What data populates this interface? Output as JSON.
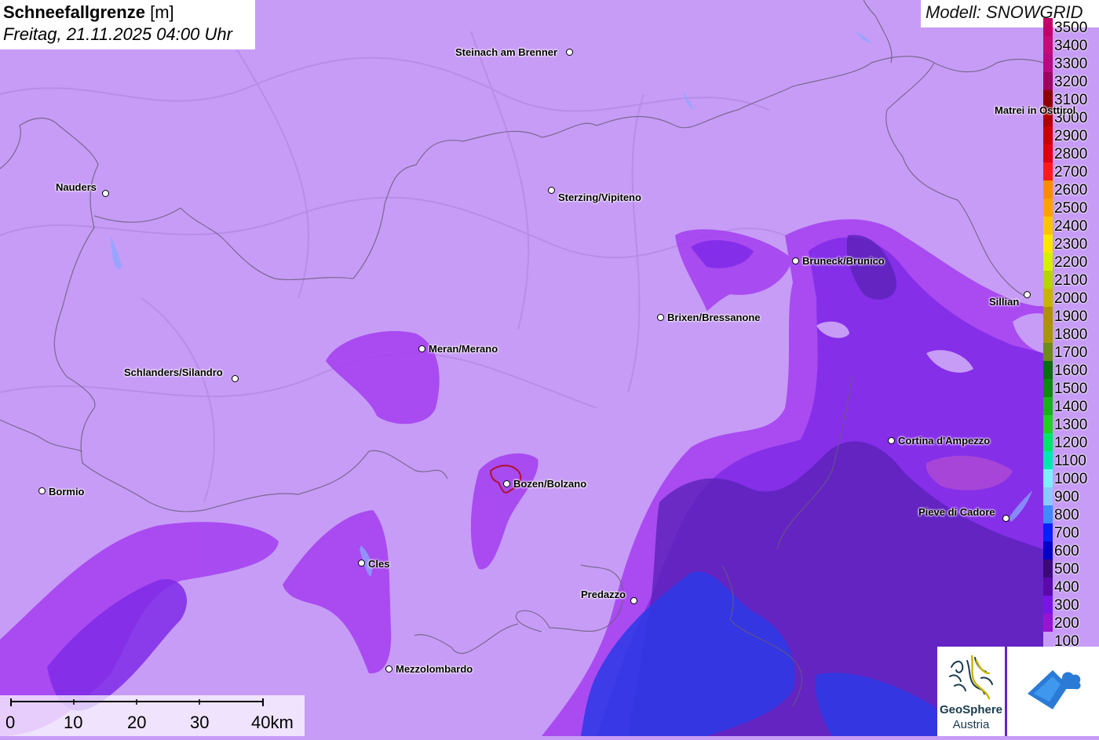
{
  "title": {
    "variable": "Schneefallgrenze",
    "unit": "[m]",
    "datetime": "Freitag, 21.11.2025 04:00 Uhr"
  },
  "model_label": "Modell: SNOWGRID",
  "legend": [
    {
      "value": "3500",
      "color": "#c4006a"
    },
    {
      "value": "3400",
      "color": "#c80a78"
    },
    {
      "value": "3300",
      "color": "#b80a80"
    },
    {
      "value": "3200",
      "color": "#9c0060"
    },
    {
      "value": "3100",
      "color": "#8c0000"
    },
    {
      "value": "3000",
      "color": "#b00000"
    },
    {
      "value": "2900",
      "color": "#cc0000"
    },
    {
      "value": "2800",
      "color": "#e00010"
    },
    {
      "value": "2700",
      "color": "#ff1a1a"
    },
    {
      "value": "2600",
      "color": "#ff8c00"
    },
    {
      "value": "2500",
      "color": "#ffa200"
    },
    {
      "value": "2400",
      "color": "#ffc400"
    },
    {
      "value": "2300",
      "color": "#ffe600"
    },
    {
      "value": "2200",
      "color": "#d4ef00"
    },
    {
      "value": "2100",
      "color": "#b6d400"
    },
    {
      "value": "2000",
      "color": "#c8b400"
    },
    {
      "value": "1900",
      "color": "#b0900a"
    },
    {
      "value": "1800",
      "color": "#a8960a"
    },
    {
      "value": "1700",
      "color": "#6c8c14"
    },
    {
      "value": "1600",
      "color": "#0a6e0a"
    },
    {
      "value": "1500",
      "color": "#0a8c0a"
    },
    {
      "value": "1400",
      "color": "#14b414"
    },
    {
      "value": "1300",
      "color": "#1ed21e"
    },
    {
      "value": "1200",
      "color": "#00e664"
    },
    {
      "value": "1100",
      "color": "#00e6b4"
    },
    {
      "value": "1000",
      "color": "#78f0ff"
    },
    {
      "value": "900",
      "color": "#8cc8ff"
    },
    {
      "value": "800",
      "color": "#3c8cff"
    },
    {
      "value": "700",
      "color": "#0a1eff"
    },
    {
      "value": "600",
      "color": "#0000c8"
    },
    {
      "value": "500",
      "color": "#3c0a78"
    },
    {
      "value": "400",
      "color": "#5a0aaa"
    },
    {
      "value": "300",
      "color": "#7814e6"
    },
    {
      "value": "200",
      "color": "#9614d2"
    },
    {
      "value": "100",
      "color": "#c79cf6"
    }
  ],
  "cities": [
    {
      "name": "Steinach am Brenner"
    },
    {
      "name": "Matrei in Osttirol"
    },
    {
      "name": "Nauders"
    },
    {
      "name": "Sterzing/Vipiteno"
    },
    {
      "name": "Bruneck/Brunico"
    },
    {
      "name": "Sillian"
    },
    {
      "name": "Brixen/Bressanone"
    },
    {
      "name": "Meran/Merano"
    },
    {
      "name": "Schlanders/Silandro"
    },
    {
      "name": "Cortina d'Ampezzo"
    },
    {
      "name": "Bormio"
    },
    {
      "name": "Bozen/Bolzano"
    },
    {
      "name": "Pieve di Cadore"
    },
    {
      "name": "Cles"
    },
    {
      "name": "Predazzo"
    },
    {
      "name": "Mezzolombardo"
    }
  ],
  "scale_bar": {
    "ticks": [
      "0",
      "10",
      "20",
      "30",
      "40km"
    ]
  },
  "logos": {
    "geosphere_line1": "GeoSphere",
    "geosphere_line2": "Austria"
  }
}
